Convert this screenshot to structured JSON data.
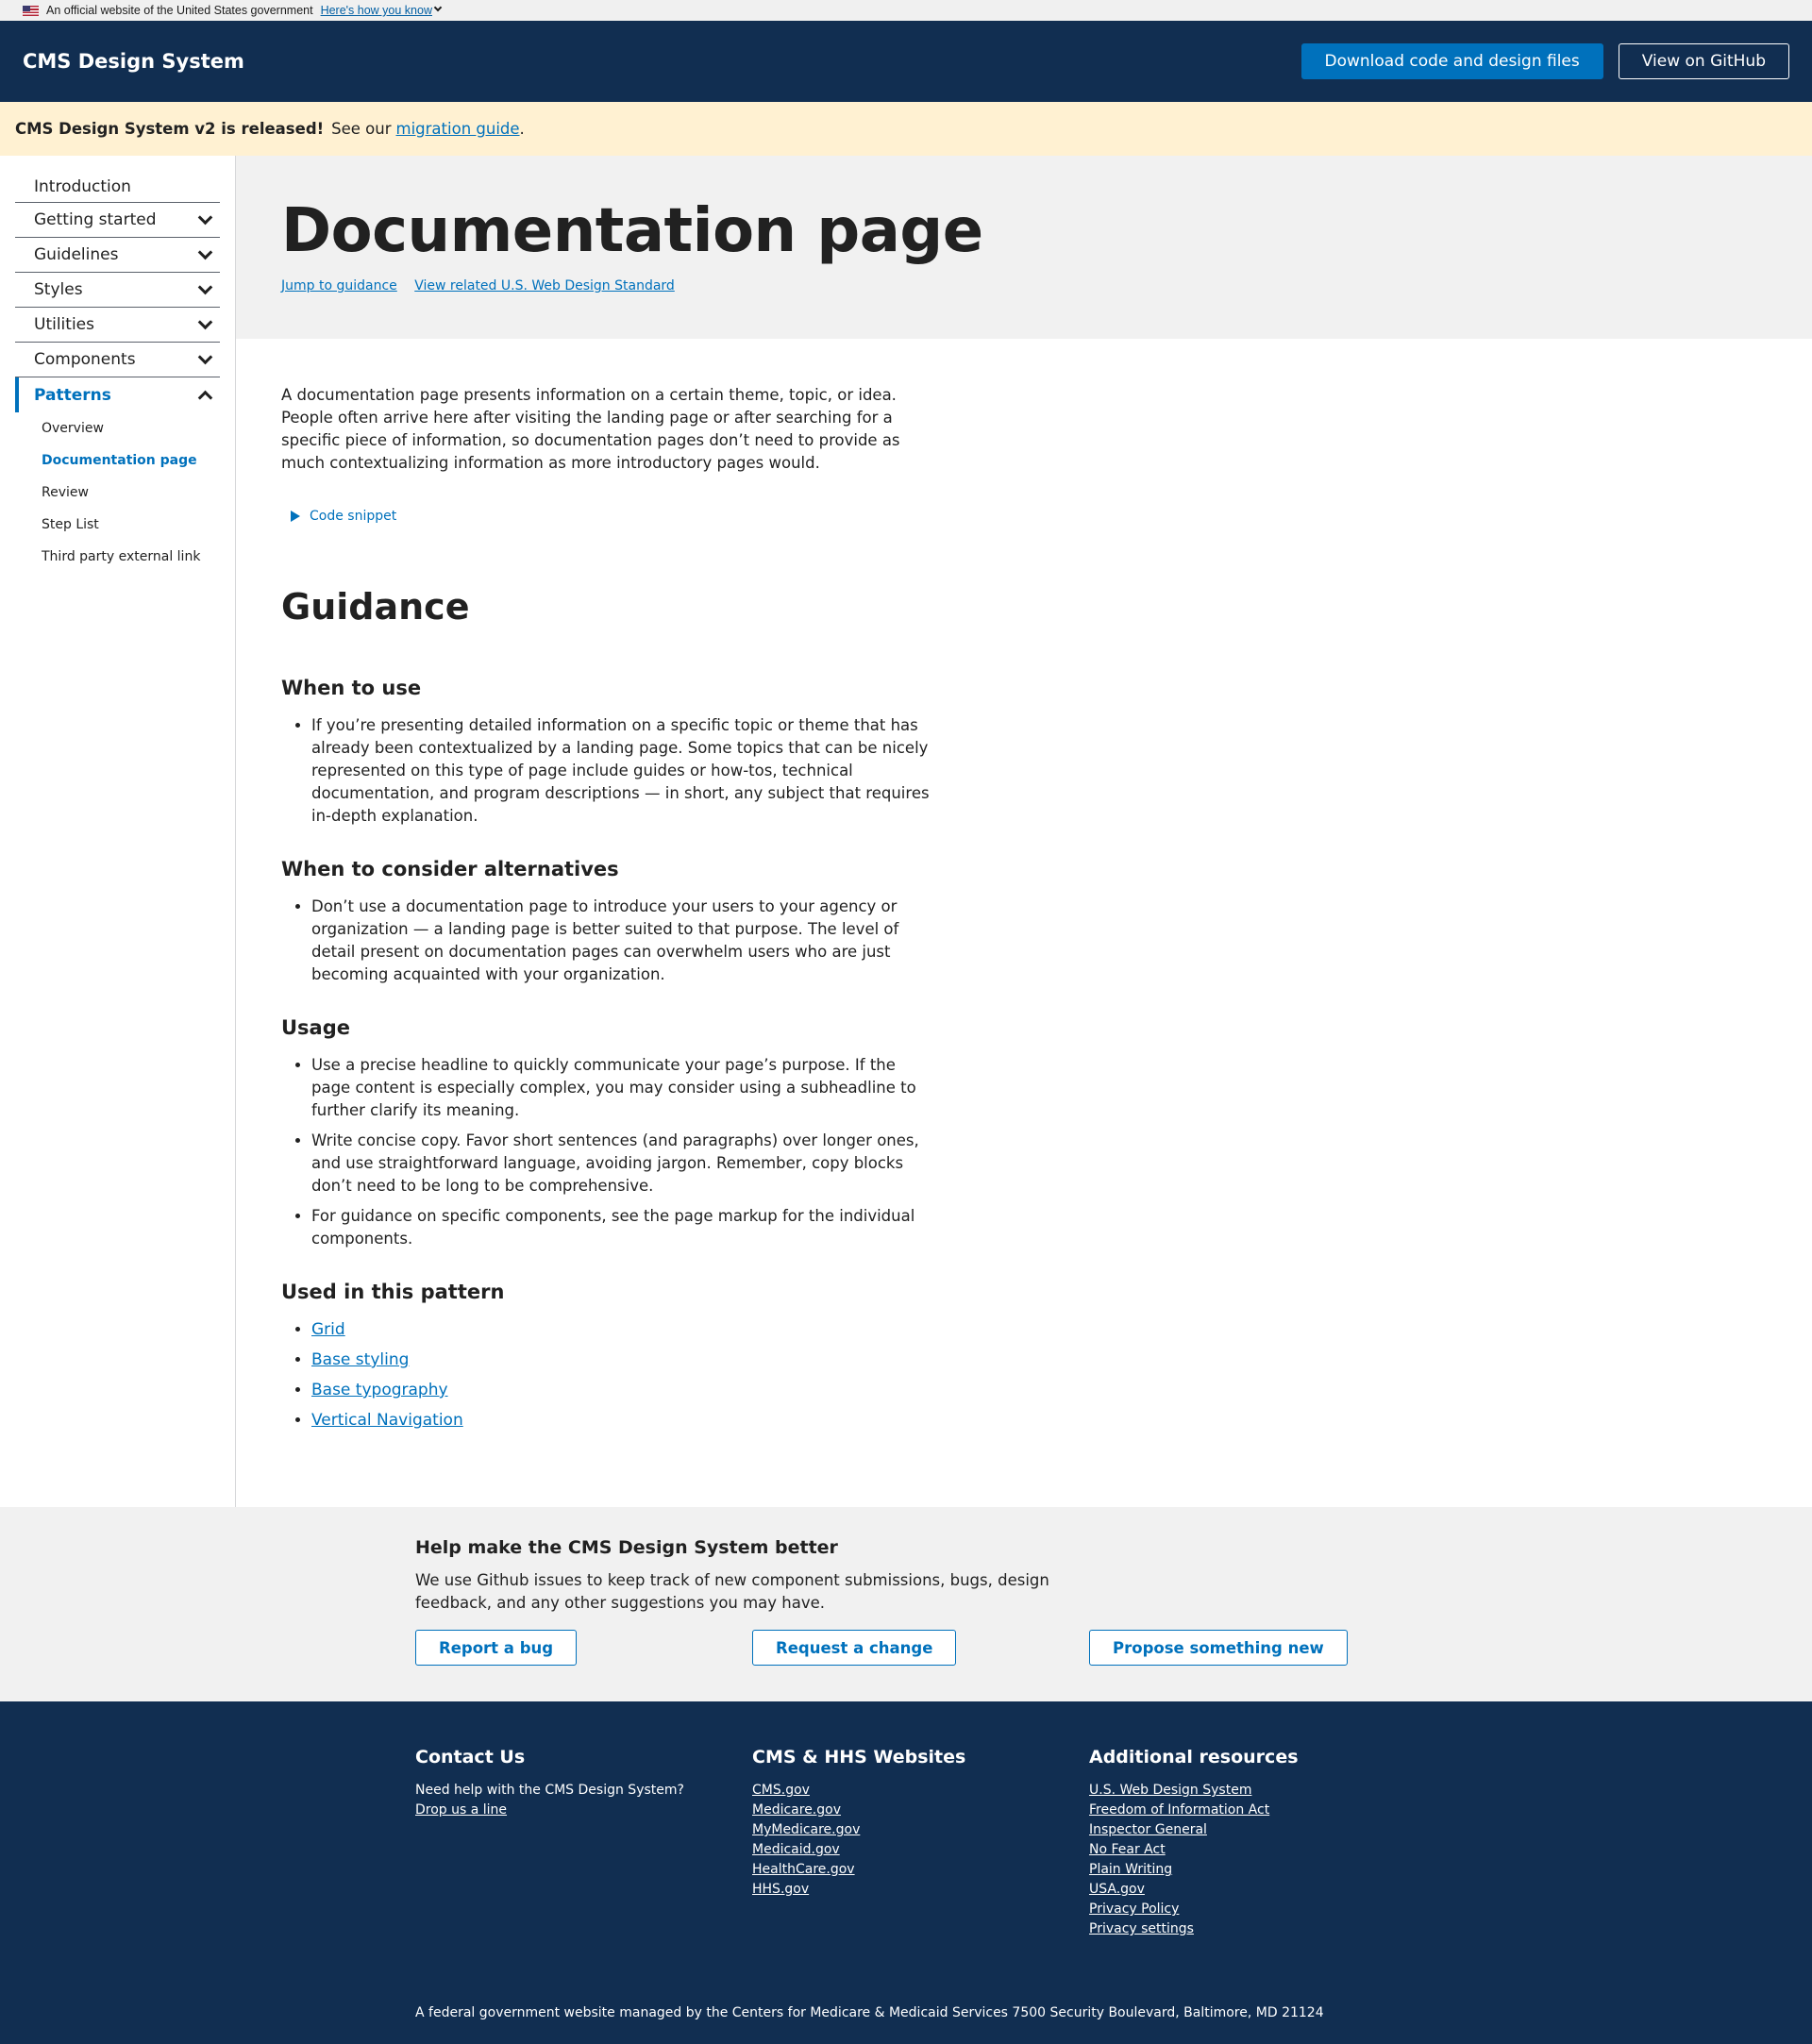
{
  "usa_banner": {
    "official_text": "An official website of the United States government",
    "how_link": "Here's how you know"
  },
  "header": {
    "title": "CMS Design System",
    "download_button": "Download code and design files",
    "github_button": "View on GitHub"
  },
  "alert": {
    "bold_text": "CMS Design System v2 is released!",
    "text": "See our",
    "link": "migration guide",
    "suffix": "."
  },
  "sidebar": {
    "items": [
      {
        "label": "Introduction"
      },
      {
        "label": "Getting started"
      },
      {
        "label": "Guidelines"
      },
      {
        "label": "Styles"
      },
      {
        "label": "Utilities"
      },
      {
        "label": "Components"
      },
      {
        "label": "Patterns"
      }
    ],
    "patterns_sub": [
      {
        "label": "Overview"
      },
      {
        "label": "Documentation page"
      },
      {
        "label": "Review"
      },
      {
        "label": "Step List"
      },
      {
        "label": "Third party external link"
      }
    ]
  },
  "hero": {
    "title": "Documentation page",
    "jump_link": "Jump to guidance",
    "related_link": "View related U.S. Web Design Standard"
  },
  "content": {
    "intro": "A documentation page presents information on a certain theme, topic, or idea. People often arrive here after visiting the landing page or after searching for a specific piece of information, so documentation pages don’t need to provide as much contextualizing information as more introductory pages would.",
    "code_snippet": "Code snippet",
    "guidance_heading": "Guidance",
    "when_to_use_heading": "When to use",
    "when_to_use": [
      "If you’re presenting detailed information on a specific topic or theme that has already been contextualized by a landing page. Some topics that can be nicely represented on this type of page include guides or how-tos, technical documentation, and program descriptions — in short, any subject that requires in-depth explanation."
    ],
    "alternatives_heading": "When to consider alternatives",
    "alternatives": [
      "Don’t use a documentation page to introduce your users to your agency or organization — a landing page is better suited to that purpose. The level of detail present on documentation pages can overwhelm users who are just becoming acquainted with your organization."
    ],
    "usage_heading": "Usage",
    "usage": [
      "Use a precise headline to quickly communicate your page’s purpose. If the page content is especially complex, you may consider using a subheadline to further clarify its meaning.",
      "Write concise copy. Favor short sentences (and paragraphs) over longer ones, and use straightforward language, avoiding jargon. Remember, copy blocks don’t need to be long to be comprehensive.",
      "For guidance on specific components, see the page markup for the individual components."
    ],
    "used_in_heading": "Used in this pattern",
    "used_in": [
      "Grid",
      "Base styling",
      "Base typography",
      "Vertical Navigation"
    ]
  },
  "help": {
    "heading": "Help make the CMS Design System better",
    "text": "We use Github issues to keep track of new component submissions, bugs, design feedback, and any other suggestions you may have.",
    "report_bug": "Report a bug",
    "request_change": "Request a change",
    "propose_new": "Propose something new"
  },
  "footer": {
    "contact_heading": "Contact Us",
    "contact_text": "Need help with the CMS Design System?",
    "contact_link": "Drop us a line",
    "websites_heading": "CMS & HHS Websites",
    "websites": [
      "CMS.gov",
      "Medicare.gov",
      "MyMedicare.gov",
      "Medicaid.gov",
      "HealthCare.gov",
      "HHS.gov"
    ],
    "resources_heading": "Additional resources",
    "resources": [
      "U.S. Web Design System",
      "Freedom of Information Act",
      "Inspector General",
      "No Fear Act",
      "Plain Writing",
      "USA.gov",
      "Privacy Policy",
      "Privacy settings"
    ],
    "bottom_text": "A federal government website managed by the Centers for Medicare & Medicaid Services 7500 Security Boulevard, Baltimore, MD 21124"
  },
  "colors": {
    "navy": "#112e51",
    "primary": "#0071bc",
    "alert_bg": "#fff1d2",
    "gray_bg": "#f1f1f1"
  }
}
